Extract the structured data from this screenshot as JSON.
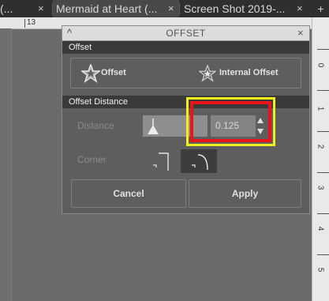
{
  "tabs": [
    {
      "label": "(...",
      "close": "×"
    },
    {
      "label": "Mermaid at Heart (...",
      "close": "×"
    },
    {
      "label": "Screen Shot 2019-...",
      "close": "×"
    }
  ],
  "new_tab_glyph": "+",
  "ruler": {
    "top_number": "13",
    "side_marks": [
      "0",
      "1",
      "2",
      "3",
      "4",
      "5"
    ]
  },
  "dialog": {
    "title": "OFFSET",
    "collapse_glyph": "^",
    "close_glyph": "×",
    "section_offset": "Offset",
    "btn_offset": "Offset",
    "btn_internal_offset": "Internal Offset",
    "section_distance": "Offset Distance",
    "label_distance": "Distance",
    "distance_value": "0.125",
    "label_corner": "Corner",
    "btn_cancel": "Cancel",
    "btn_apply": "Apply"
  },
  "colors": {
    "highlight_outer": "#f2ef1a",
    "highlight_inner": "#e8141a"
  }
}
